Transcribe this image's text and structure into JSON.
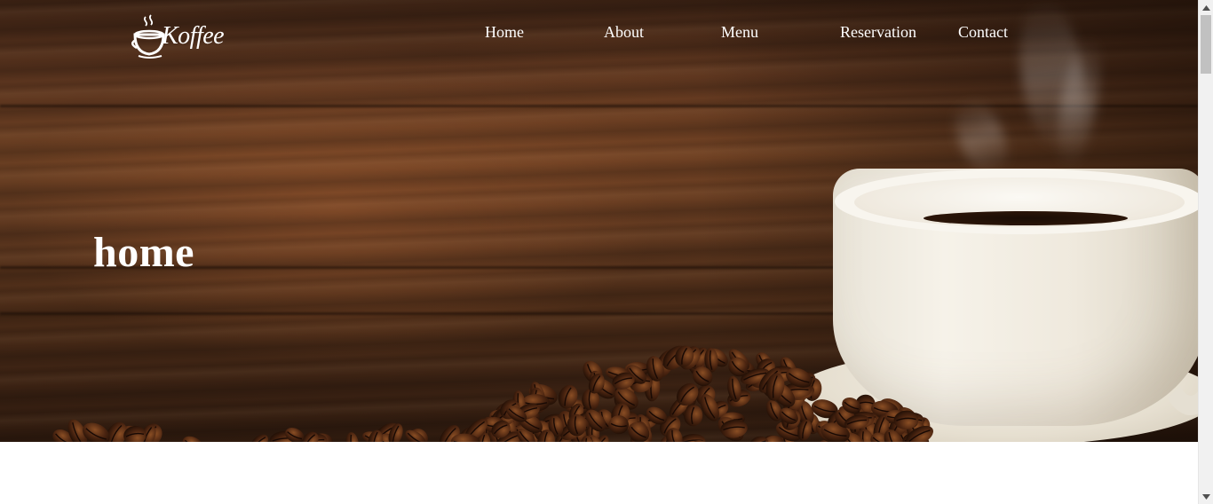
{
  "brand": {
    "logo_text": "Koffee",
    "logo_icon": "coffee-cup-icon"
  },
  "nav": {
    "items": [
      {
        "label": "Home"
      },
      {
        "label": "About"
      },
      {
        "label": "Menu"
      },
      {
        "label": "Reservation"
      },
      {
        "label": "Contact"
      }
    ]
  },
  "hero": {
    "title": "home",
    "background_image": "coffee-cup-and-beans-on-wood"
  },
  "scrollbar": {
    "up_icon": "scroll-up-arrow-icon",
    "down_icon": "scroll-down-arrow-icon"
  },
  "colors": {
    "nav_text": "#ffffff",
    "hero_title": "#ffffff",
    "page_background": "#ffffff",
    "scrollbar_track": "#f1f1f1",
    "scrollbar_thumb": "#c1c1c1"
  }
}
